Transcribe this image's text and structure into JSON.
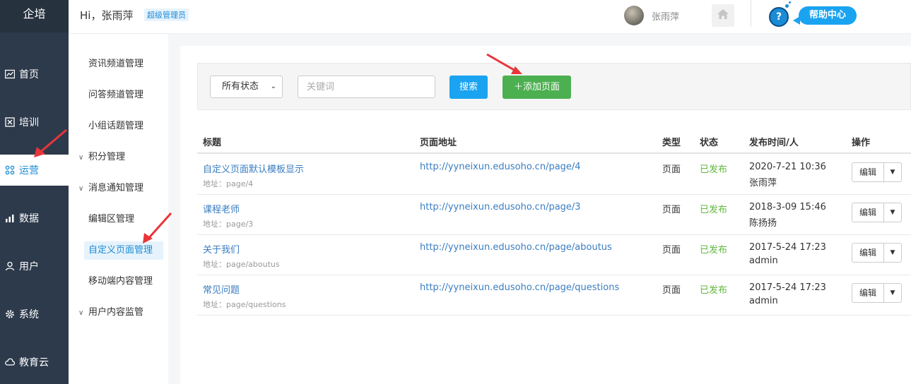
{
  "brand": "企培",
  "header": {
    "greeting": "Hi，张雨萍",
    "role": "超级管理员",
    "user_name": "张雨萍",
    "help_label": "帮助中心"
  },
  "nav": [
    {
      "label": "首页",
      "icon": "chart-icon"
    },
    {
      "label": "培训",
      "icon": "book-icon"
    },
    {
      "label": "运营",
      "icon": "operations-icon",
      "active": true
    },
    {
      "label": "数据",
      "icon": "bar-chart-icon"
    },
    {
      "label": "用户",
      "icon": "user-icon"
    },
    {
      "label": "系统",
      "icon": "gear-icon"
    },
    {
      "label": "教育云",
      "icon": "cloud-icon"
    }
  ],
  "submenu": [
    {
      "label": "资讯频道管理"
    },
    {
      "label": "问答频道管理"
    },
    {
      "label": "小组话题管理"
    },
    {
      "label": "积分管理",
      "expandable": true
    },
    {
      "label": "消息通知管理",
      "expandable": true
    },
    {
      "label": "编辑区管理"
    },
    {
      "label": "自定义页面管理",
      "active": true
    },
    {
      "label": "移动端内容管理"
    },
    {
      "label": "用户内容监管",
      "expandable": true
    }
  ],
  "filters": {
    "status_selected": "所有状态",
    "keyword_placeholder": "关键词",
    "search_label": "搜索",
    "add_label": "＋添加页面"
  },
  "table": {
    "headers": [
      "标题",
      "页面地址",
      "类型",
      "状态",
      "发布时间/人",
      "操作"
    ],
    "rows": [
      {
        "title": "自定义页面默认模板显示",
        "addr": "地址：page/4",
        "url": "http://yyneixun.edusoho.cn/page/4",
        "type": "页面",
        "status": "已发布",
        "time": "2020-7-21 10:36",
        "user": "张雨萍",
        "edit": "编辑"
      },
      {
        "title": "课程老师",
        "addr": "地址：page/3",
        "url": "http://yyneixun.edusoho.cn/page/3",
        "type": "页面",
        "status": "已发布",
        "time": "2018-3-09 15:46",
        "user": "陈扬扬",
        "edit": "编辑"
      },
      {
        "title": "关于我们",
        "addr": "地址：page/aboutus",
        "url": "http://yyneixun.edusoho.cn/page/aboutus",
        "type": "页面",
        "status": "已发布",
        "time": "2017-5-24 17:23",
        "user": "admin",
        "edit": "编辑"
      },
      {
        "title": "常见问题",
        "addr": "地址：page/questions",
        "url": "http://yyneixun.edusoho.cn/page/questions",
        "type": "页面",
        "status": "已发布",
        "time": "2017-5-24 17:23",
        "user": "admin",
        "edit": "编辑"
      }
    ]
  },
  "colors": {
    "nav_bg": "#2d3a4b",
    "accent": "#1aa3f0",
    "add_green": "#4caf50",
    "status_green": "#5fb83b",
    "arrow_red": "#e8353a"
  }
}
